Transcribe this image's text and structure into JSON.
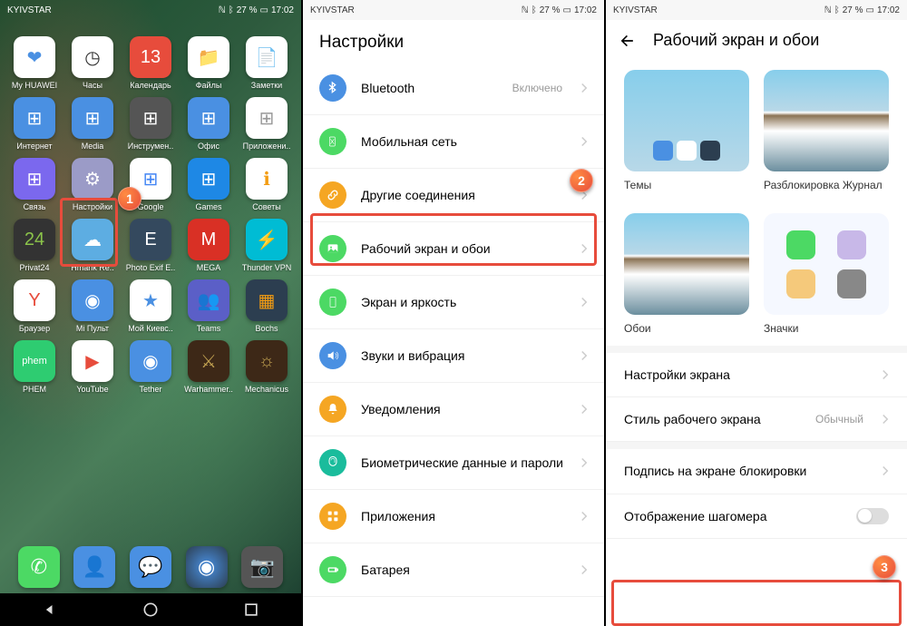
{
  "status": {
    "carrier": "KYIVSTAR",
    "battery": "27 %",
    "time": "17:02"
  },
  "badges": {
    "b1": "1",
    "b2": "2",
    "b3": "3"
  },
  "home": {
    "apps": [
      {
        "name": "My HUAWEI",
        "bg": "#fff",
        "fg": "#4a90e2",
        "icon": "❤"
      },
      {
        "name": "Часы",
        "bg": "#fff",
        "fg": "#333",
        "icon": "◷"
      },
      {
        "name": "Календарь",
        "bg": "#e74c3c",
        "fg": "#fff",
        "icon": "13"
      },
      {
        "name": "Файлы",
        "bg": "#fff",
        "fg": "#f5a623",
        "icon": "📁"
      },
      {
        "name": "Заметки",
        "bg": "#fff",
        "fg": "#f5a623",
        "icon": "📄"
      },
      {
        "name": "Интернет",
        "bg": "#4a90e2",
        "fg": "#fff",
        "icon": "⊞"
      },
      {
        "name": "Media",
        "bg": "#4a90e2",
        "fg": "#fff",
        "icon": "⊞"
      },
      {
        "name": "Инструмен..",
        "bg": "#555",
        "fg": "#fff",
        "icon": "⊞"
      },
      {
        "name": "Офис",
        "bg": "#4a90e2",
        "fg": "#fff",
        "icon": "⊞"
      },
      {
        "name": "Приложени..",
        "bg": "#fff",
        "fg": "#999",
        "icon": "⊞"
      },
      {
        "name": "Связь",
        "bg": "#7b68ee",
        "fg": "#fff",
        "icon": "⊞"
      },
      {
        "name": "Настройки",
        "bg": "#9b9bc7",
        "fg": "#fff",
        "icon": "⚙"
      },
      {
        "name": "Google",
        "bg": "#fff",
        "fg": "#4285f4",
        "icon": "⊞"
      },
      {
        "name": "Games",
        "bg": "#1e88e5",
        "fg": "#fff",
        "icon": "⊞"
      },
      {
        "name": "Советы",
        "bg": "#fff",
        "fg": "#f39c12",
        "icon": "ℹ"
      },
      {
        "name": "Privat24",
        "bg": "#333",
        "fg": "#8bc34a",
        "icon": "24"
      },
      {
        "name": "Hmarik Re..",
        "bg": "#5dade2",
        "fg": "#fff",
        "icon": "☁"
      },
      {
        "name": "Photo Exif E..",
        "bg": "#34495e",
        "fg": "#fff",
        "icon": "E"
      },
      {
        "name": "MEGA",
        "bg": "#d93025",
        "fg": "#fff",
        "icon": "M"
      },
      {
        "name": "Thunder VPN",
        "bg": "#00bcd4",
        "fg": "#fff",
        "icon": "⚡"
      },
      {
        "name": "Браузер",
        "bg": "#fff",
        "fg": "#e74c3c",
        "icon": "Y"
      },
      {
        "name": "Mi Пульт",
        "bg": "#4a90e2",
        "fg": "#fff",
        "icon": "◉"
      },
      {
        "name": "Мой Киевс..",
        "bg": "#fff",
        "fg": "#4a90e2",
        "icon": "★"
      },
      {
        "name": "Teams",
        "bg": "#5b5fc7",
        "fg": "#fff",
        "icon": "👥"
      },
      {
        "name": "Bochs",
        "bg": "#2c3e50",
        "fg": "#f39c12",
        "icon": "▦"
      },
      {
        "name": "PHEM",
        "bg": "#2ecc71",
        "fg": "#fff",
        "icon": "phem"
      },
      {
        "name": "YouTube",
        "bg": "#fff",
        "fg": "#e74c3c",
        "icon": "▶"
      },
      {
        "name": "Tether",
        "bg": "#4a90e2",
        "fg": "#fff",
        "icon": "◉"
      },
      {
        "name": "Warhammer..",
        "bg": "#3d2817",
        "fg": "#c0a050",
        "icon": "⚔"
      },
      {
        "name": "Mechanicus",
        "bg": "#3d2817",
        "fg": "#c0a050",
        "icon": "☼"
      }
    ],
    "dock": [
      {
        "name": "phone",
        "bg": "#4cd964",
        "icon": "✆"
      },
      {
        "name": "contacts",
        "bg": "#4a90e2",
        "icon": "👤"
      },
      {
        "name": "messages",
        "bg": "#4a90e2",
        "icon": "💬"
      },
      {
        "name": "ai",
        "bg": "radial-gradient(circle,#4a90e2,#2c3e50)",
        "icon": "◉"
      },
      {
        "name": "camera",
        "bg": "#555",
        "icon": "📷"
      }
    ]
  },
  "settings": {
    "title": "Настройки",
    "items": [
      {
        "icon": "bt",
        "bg": "#4a90e2",
        "label": "Bluetooth",
        "value": "Включено"
      },
      {
        "icon": "sim",
        "bg": "#4cd964",
        "label": "Мобильная сеть"
      },
      {
        "icon": "link",
        "bg": "#f5a623",
        "label": "Другие соединения"
      },
      {
        "icon": "img",
        "bg": "#4cd964",
        "label": "Рабочий экран и обои",
        "highlight": true
      },
      {
        "icon": "disp",
        "bg": "#4cd964",
        "label": "Экран и яркость"
      },
      {
        "icon": "snd",
        "bg": "#4a90e2",
        "label": "Звуки и вибрация"
      },
      {
        "icon": "bell",
        "bg": "#f5a623",
        "label": "Уведомления"
      },
      {
        "icon": "bio",
        "bg": "#1abc9c",
        "label": "Биометрические данные и пароли"
      },
      {
        "icon": "apps",
        "bg": "#f5a623",
        "label": "Приложения"
      },
      {
        "icon": "bat",
        "bg": "#4cd964",
        "label": "Батарея"
      }
    ]
  },
  "wallpaper": {
    "title": "Рабочий экран и обои",
    "themes": "Темы",
    "unlock": "Разблокировка Журнал",
    "wall": "Обои",
    "icons": "Значки",
    "items": [
      {
        "label": "Настройки экрана"
      },
      {
        "label": "Стиль рабочего экрана",
        "value": "Обычный"
      },
      {
        "label": "Подпись на экране блокировки"
      },
      {
        "label": "Отображение шагомера",
        "toggle": true,
        "highlight": true
      }
    ]
  }
}
